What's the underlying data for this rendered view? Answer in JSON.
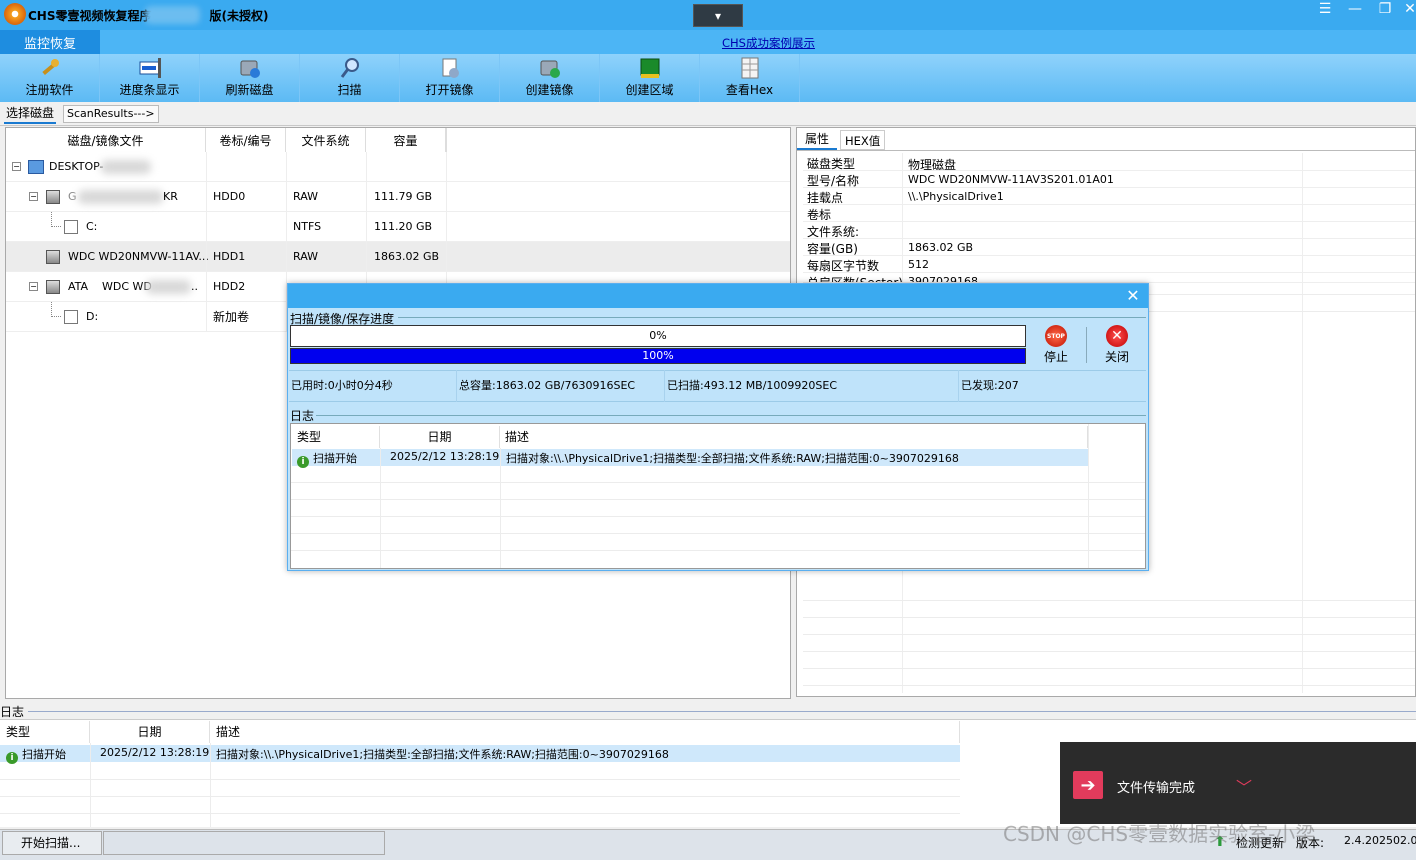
{
  "window": {
    "title": "CHS零壹视频恢复程序",
    "title_suffix": "版(未授权)",
    "dropdown_glyph": "▾",
    "controls": [
      "☰",
      "—",
      "❐",
      "✕"
    ]
  },
  "menubar": {
    "active_tab": "监控恢复",
    "link": "CHS成功案例展示"
  },
  "toolbar": [
    {
      "label": "注册软件",
      "icon": "key-tools-icon"
    },
    {
      "label": "进度条显示",
      "icon": "progress-window-icon"
    },
    {
      "label": "刷新磁盘",
      "icon": "refresh-disk-icon"
    },
    {
      "label": "扫描",
      "icon": "magnifier-icon"
    },
    {
      "label": "打开镜像",
      "icon": "open-image-icon"
    },
    {
      "label": "创建镜像",
      "icon": "create-image-icon"
    },
    {
      "label": "创建区域",
      "icon": "create-region-icon"
    },
    {
      "label": "查看Hex",
      "icon": "hex-grid-icon"
    }
  ],
  "subtabs": {
    "select_disk": "选择磁盘",
    "scan_results": "ScanResults--->"
  },
  "disk_table": {
    "headers": [
      "磁盘/镜像文件",
      "卷标/编号",
      "文件系统",
      "容量"
    ],
    "rows": [
      {
        "name": "DESKTOP-",
        "id": "",
        "fs": "",
        "size": ""
      },
      {
        "name": "G",
        "name_tail": "KR",
        "id": "HDD0",
        "fs": "RAW",
        "size": "111.79 GB"
      },
      {
        "name": "C:",
        "id": "",
        "fs": "NTFS",
        "size": "111.20 GB"
      },
      {
        "name": "WDC WD20NMVW-11AV...",
        "id": "HDD1",
        "fs": "RAW",
        "size": "1863.02 GB"
      },
      {
        "name": "ATA",
        "name2": "WDC WD",
        "name_tail": "..",
        "id": "HDD2",
        "fs": "",
        "size": ""
      },
      {
        "name": "D:",
        "id": "新加卷",
        "fs": "",
        "size": ""
      }
    ]
  },
  "right_tabs": {
    "attributes": "属性",
    "hex": "HEX值"
  },
  "properties": [
    {
      "key": "磁盘类型",
      "value": "物理磁盘"
    },
    {
      "key": "型号/名称",
      "value": "WDC WD20NMVW-11AV3S201.01A01"
    },
    {
      "key": "挂载点",
      "value": "\\\\.\\PhysicalDrive1"
    },
    {
      "key": "卷标",
      "value": ""
    },
    {
      "key": "文件系统:",
      "value": ""
    },
    {
      "key": "容量(GB)",
      "value": "1863.02 GB"
    },
    {
      "key": "每扇区字节数",
      "value": "512"
    },
    {
      "key": "总扇区数(Sector)",
      "value": "3907029168"
    }
  ],
  "dialog": {
    "section_title": "扫描/镜像/保存进度",
    "progress1_text": "0%",
    "progress1_value": 0,
    "progress2_text": "100%",
    "progress2_value": 100,
    "stop_label": "停止",
    "stop_icon_text": "STOP",
    "close_label": "关闭",
    "stats": {
      "elapsed": "已用时:0小时0分4秒",
      "total": "总容量:1863.02 GB/7630916SEC",
      "scanned": "已扫描:493.12 MB/1009920SEC",
      "found": "已发现:207"
    },
    "log_title": "日志",
    "log_headers": [
      "类型",
      "日期",
      "描述"
    ],
    "log_rows": [
      {
        "type": "扫描开始",
        "date": "2025/2/12 13:28:19",
        "desc": "扫描对象:\\\\.\\PhysicalDrive1;扫描类型:全部扫描;文件系统:RAW;扫描范围:0~3907029168"
      }
    ]
  },
  "bottom_log": {
    "title": "日志",
    "headers": [
      "类型",
      "日期",
      "描述"
    ],
    "rows": [
      {
        "type": "扫描开始",
        "date": "2025/2/12 13:28:19",
        "desc": "扫描对象:\\\\.\\PhysicalDrive1;扫描类型:全部扫描;文件系统:RAW;扫描范围:0~3907029168"
      }
    ]
  },
  "statusbar": {
    "status": "开始扫描...",
    "updates": "检测更新",
    "version_label": "版本:",
    "version_value": "2.4.202502.0"
  },
  "toast": {
    "text": "文件传输完成"
  },
  "watermark": "CSDN @CHS零壹数据实验室-小梁"
}
